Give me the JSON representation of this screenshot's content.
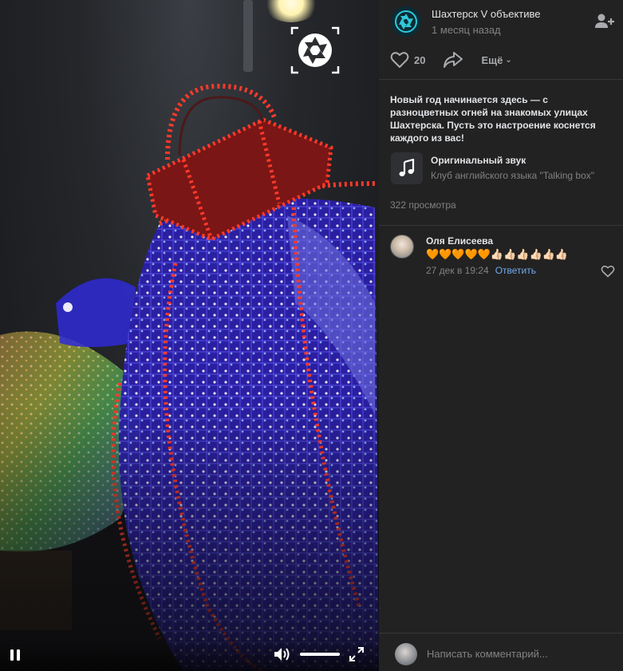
{
  "channel": {
    "name": "Шахтерск V объективе",
    "date": "1 месяц назад"
  },
  "actions": {
    "like_count": "20",
    "more_label": "Ещё"
  },
  "post": {
    "description": "Новый год начинается здесь — с разноцветных огней на знакомых улицах Шахтерска. Пусть это настроение коснется каждого из вас!",
    "audio_title": "Оригинальный звук",
    "audio_artist": "Клуб английского языка \"Talking box\"",
    "views": "322 просмотра"
  },
  "comments": [
    {
      "author": "Оля Елисеева",
      "text": "🧡🧡🧡🧡🧡👍🏻👍🏻👍🏻👍🏻👍🏻👍🏻",
      "date": "27 дек в 19:24",
      "reply_label": "Ответить"
    }
  ],
  "composer": {
    "placeholder": "Написать комментарий..."
  },
  "video": {
    "volume_level": 1.0
  },
  "icons": {
    "like": "heart-icon",
    "share": "share-icon",
    "add_friend": "add-friend-icon",
    "audio": "music-note-icon",
    "pause": "pause-icon",
    "volume": "volume-icon",
    "fullscreen": "fullscreen-icon",
    "logo": "camera-shutter-icon"
  },
  "colors": {
    "accent_link": "#71aaeb",
    "panel_bg": "#222222",
    "muted_text": "#828282"
  }
}
